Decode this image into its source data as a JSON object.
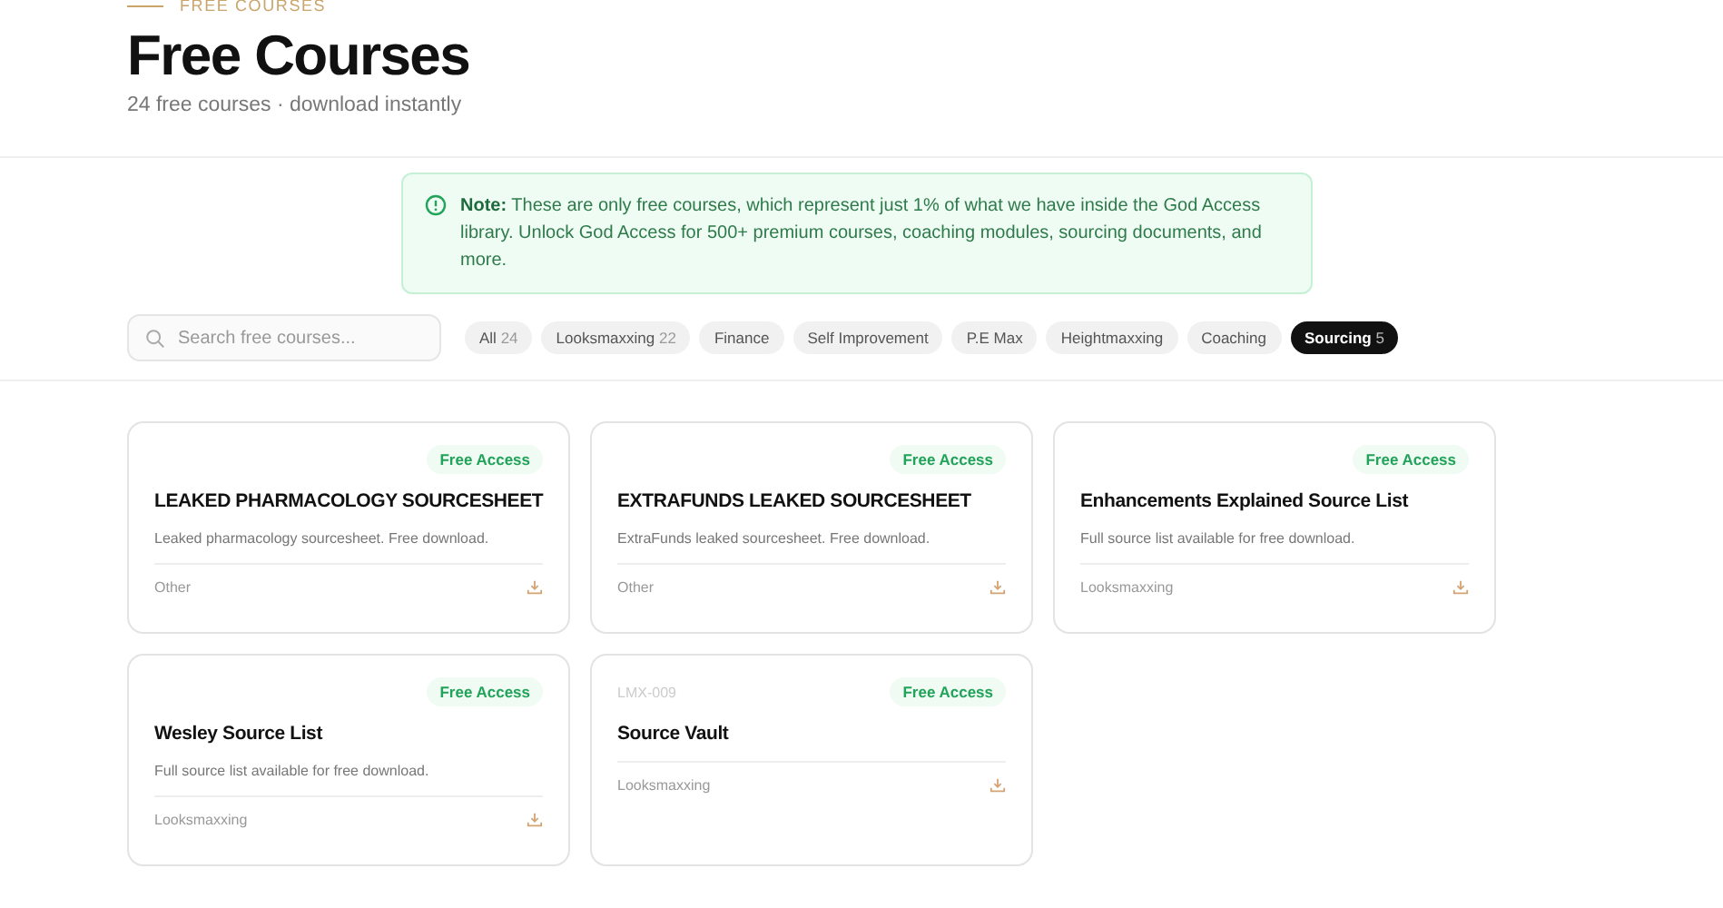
{
  "header": {
    "eyebrow": "FREE COURSES",
    "title": "Free Courses",
    "subtitle": "24 free courses · download instantly"
  },
  "note": {
    "text": "**Note:** These are only free courses, which represent just 1% of what we have inside the God Access library. Unlock God Access for 500+ premium courses, coaching modules, sourcing documents, and more."
  },
  "search": {
    "placeholder": "Search free courses..."
  },
  "filters": [
    {
      "label": "All",
      "count": "24",
      "selected": false
    },
    {
      "label": "Looksmaxxing",
      "count": "22",
      "selected": false
    },
    {
      "label": "Finance",
      "selected": false
    },
    {
      "label": "Self Improvement",
      "selected": false
    },
    {
      "label": "P.E Max",
      "selected": false
    },
    {
      "label": "Heightmaxxing",
      "selected": false
    },
    {
      "label": "Coaching",
      "selected": false
    },
    {
      "label": "Sourcing",
      "count": "5",
      "selected": true
    }
  ],
  "courses": [
    {
      "badge": "Free Access",
      "title": "LEAKED PHARMACOLOGY SOURCESHEET",
      "description": "Leaked pharmacology sourcesheet. Free download.",
      "category": "Other"
    },
    {
      "badge": "Free Access",
      "title": "EXTRAFUNDS LEAKED SOURCESHEET",
      "description": "ExtraFunds leaked sourcesheet. Free download.",
      "category": "Other"
    },
    {
      "badge": "Free Access",
      "title": "Enhancements Explained Source List",
      "description": "Full source list available for free download.",
      "category": "Looksmaxxing"
    },
    {
      "badge": "Free Access",
      "title": "Wesley Source List",
      "description": "Full source list available for free download.",
      "category": "Looksmaxxing"
    },
    {
      "code": "LMX-009",
      "badge": "Free Access",
      "title": "Source Vault",
      "category": "Looksmaxxing"
    }
  ]
}
